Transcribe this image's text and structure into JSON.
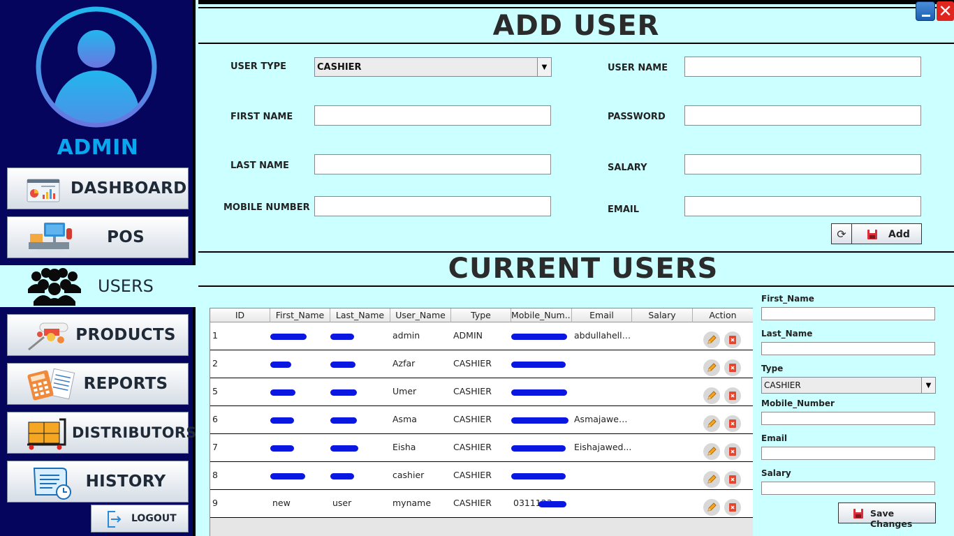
{
  "sidebar": {
    "admin_label": "ADMIN",
    "nav": {
      "dashboard": "DASHBOARD",
      "pos": "POS",
      "users": "USERS",
      "products": "PRODUCTS",
      "reports": "REPORTS",
      "distributors": "DISTRIBUTORS",
      "history": "HISTORY"
    },
    "logout": "LOGOUT"
  },
  "add_user": {
    "title": "ADD USER",
    "labels": {
      "user_type": "USER TYPE",
      "user_name": "USER NAME",
      "first_name": "FIRST NAME",
      "password": "PASSWORD",
      "last_name": "LAST NAME",
      "salary": "SALARY",
      "mobile_number": "MOBILE NUMBER",
      "email": "EMAIL"
    },
    "values": {
      "user_type": "CASHIER",
      "user_name": "",
      "first_name": "",
      "password": "",
      "last_name": "",
      "salary": "",
      "mobile_number": "",
      "email": ""
    },
    "add_label": "Add"
  },
  "current_users": {
    "title": "CURRENT USERS",
    "columns": [
      "ID",
      "First_Name",
      "Last_Name",
      "User_Name",
      "Type",
      "Mobile_Num...",
      "Email",
      "Salary",
      "Action"
    ],
    "rows": [
      {
        "id": "1",
        "first_name": "",
        "last_name": "",
        "user_name": "admin",
        "type": "ADMIN",
        "mobile": "",
        "email": "abdullahella...",
        "salary": ""
      },
      {
        "id": "2",
        "first_name": "",
        "last_name": "",
        "user_name": "Azfar",
        "type": "CASHIER",
        "mobile": "",
        "email": "",
        "salary": ""
      },
      {
        "id": "5",
        "first_name": "",
        "last_name": "",
        "user_name": "Umer",
        "type": "CASHIER",
        "mobile": "",
        "email": "",
        "salary": ""
      },
      {
        "id": "6",
        "first_name": "",
        "last_name": "",
        "user_name": "Asma",
        "type": "CASHIER",
        "mobile": "",
        "email": "Asmajawed...",
        "salary": ""
      },
      {
        "id": "7",
        "first_name": "",
        "last_name": "",
        "user_name": "Eisha",
        "type": "CASHIER",
        "mobile": "",
        "email": "Eishajawed...",
        "salary": ""
      },
      {
        "id": "8",
        "first_name": "",
        "last_name": "",
        "user_name": "cashier",
        "type": "CASHIER",
        "mobile": "",
        "email": "",
        "salary": ""
      },
      {
        "id": "9",
        "first_name": "new",
        "last_name": "user",
        "user_name": "myname",
        "type": "CASHIER",
        "mobile": "0311123",
        "email": "",
        "salary": ""
      }
    ]
  },
  "edit_panel": {
    "labels": {
      "first_name": "First_Name",
      "last_name": "Last_Name",
      "type": "Type",
      "mobile_number": "Mobile_Number",
      "email": "Email",
      "salary": "Salary"
    },
    "values": {
      "first_name": "",
      "last_name": "",
      "type": "CASHIER",
      "mobile_number": "",
      "email": "",
      "salary": ""
    },
    "save_label": "Save Changes"
  },
  "colors": {
    "sidebar_bg": "#05055e",
    "main_bg": "#ccffff",
    "admin_text": "#0aa6ee",
    "redaction": "#0a17e0"
  },
  "icons": {
    "avatar": "user-avatar-icon",
    "dashboard": "dashboard-chart-icon",
    "pos": "pos-terminal-icon",
    "users": "users-group-icon",
    "products": "products-icon",
    "reports": "reports-calculator-icon",
    "distributors": "distributors-cart-icon",
    "history": "history-document-icon",
    "logout": "logout-icon",
    "refresh": "refresh-icon",
    "save": "save-icon",
    "edit": "edit-pencil-icon",
    "delete": "delete-icon"
  }
}
